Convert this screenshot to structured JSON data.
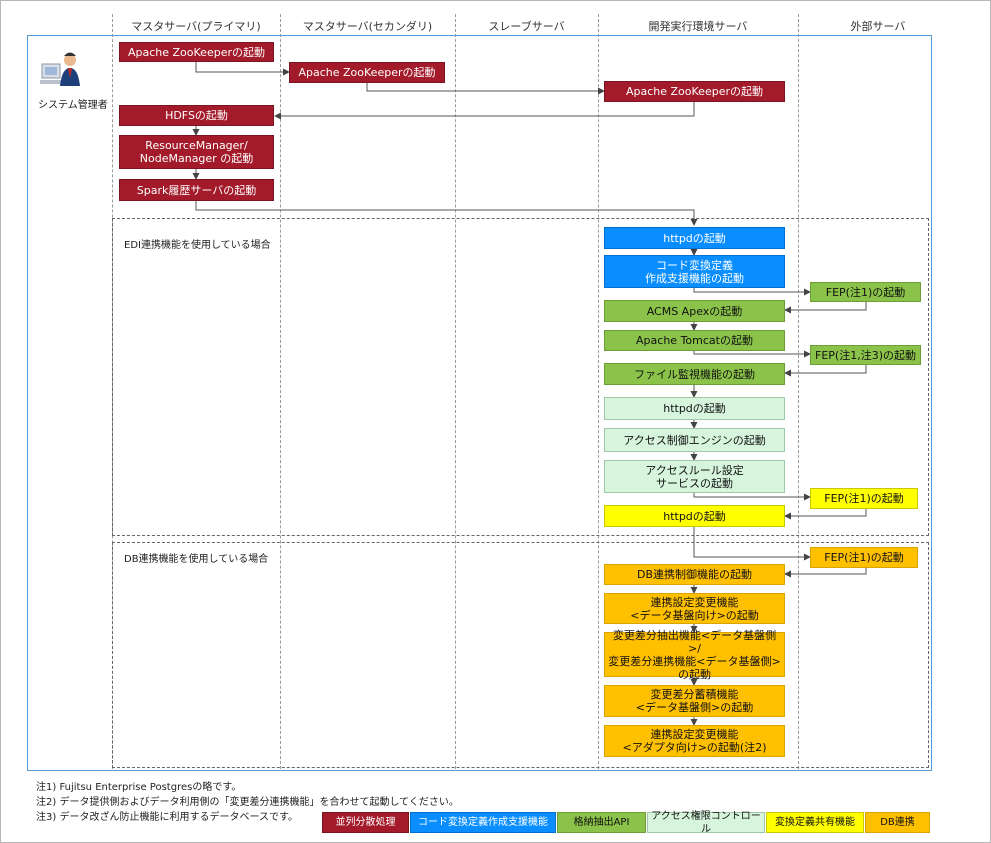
{
  "lanes": [
    "マスタサーバ(プライマリ)",
    "マスタサーバ(セカンダリ)",
    "スレーブサーバ",
    "開発実行環境サーバ",
    "外部サーバ"
  ],
  "admin_label": "システム管理者",
  "groups": {
    "edi": "EDI連携機能を使用している場合",
    "db": "DB連携機能を使用している場合"
  },
  "steps": [
    "Apache ZooKeeperの起動",
    "Apache ZooKeeperの起動",
    "Apache ZooKeeperの起動",
    "HDFSの起動",
    "ResourceManager/\nNodeManager の起動",
    "Spark履歴サーバの起動",
    "httpdの起動",
    "コード変換定義\n作成支援機能の起動",
    "FEP(注1)の起動",
    "ACMS Apexの起動",
    "Apache Tomcatの起動",
    "FEP(注1,注3)の起動",
    "ファイル監視機能の起動",
    "httpdの起動",
    "アクセス制御エンジンの起動",
    "アクセスルール設定\nサービスの起動",
    "FEP(注1)の起動",
    "httpdの起動",
    "FEP(注1)の起動",
    "DB連携制御機能の起動",
    "連携設定変更機能\n<データ基盤向け>の起動",
    "変更差分抽出機能<データ基盤側>/\n変更差分連携機能<データ基盤側>\nの起動",
    "変更差分蓄積機能\n<データ基盤側>の起動",
    "連携設定変更機能\n<アダプタ向け>の起動(注2)"
  ],
  "notes": [
    "注1) Fujitsu Enterprise Postgresの略です。",
    "注2) データ提供側およびデータ利用側の「変更差分連携機能」を合わせて起動してください。",
    "注3) データ改ざん防止機能に利用するデータベースです。"
  ],
  "legend": [
    "並列分散処理",
    "コード変換定義作成支援機能",
    "格納抽出API",
    "アクセス権限コントロール",
    "変換定義共有機能",
    "DB連携"
  ],
  "colors": {
    "red": "#a31b2a",
    "blue": "#0a8eff",
    "green": "#8bc34a",
    "light_green": "#d6f5dc",
    "yellow": "#ffff00",
    "orange": "#ffc000",
    "frame": "#5b9bd5"
  }
}
